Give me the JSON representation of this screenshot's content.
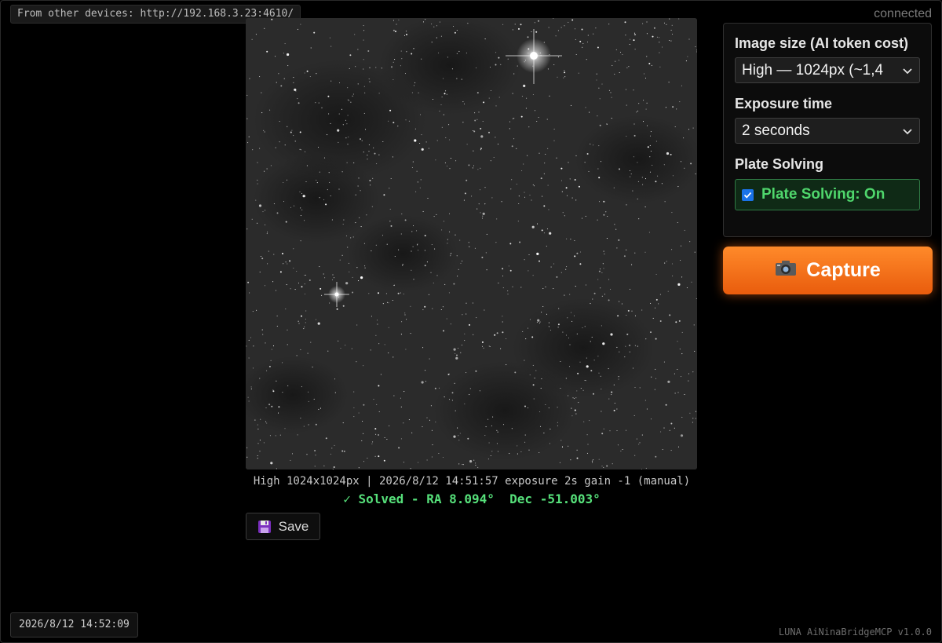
{
  "header": {
    "device_url_text": "From other devices: http://192.168.3.23:4610/",
    "connection_status": "connected"
  },
  "image_view": {
    "caption": "High 1024x1024px | 2026/8/12 14:51:57 exposure 2s gain -1 (manual)",
    "solve_status": "✓ Solved - RA 8.094°  Dec -51.003°",
    "save_label": "Save",
    "save_icon": "floppy-disk-icon"
  },
  "settings": {
    "image_size_label": "Image size (AI token cost)",
    "image_size_value": "High — 1024px (~1,4",
    "exposure_label": "Exposure time",
    "exposure_value": "2 seconds",
    "plate_solving_label": "Plate Solving",
    "plate_solving_toggle_label": "Plate Solving: On",
    "plate_solving_checked": true
  },
  "capture": {
    "label": "Capture",
    "icon": "camera-icon"
  },
  "footer": {
    "timestamp": "2026/8/12 14:52:09",
    "app_version": "LUNA AiNinaBridgeMCP v1.0.0"
  },
  "colors": {
    "background": "#000000",
    "accent_orange": "#f26f1a",
    "solved_green": "#56e07a",
    "toggle_green": "#4fd66c",
    "checkbox_blue": "#1a73e8"
  }
}
